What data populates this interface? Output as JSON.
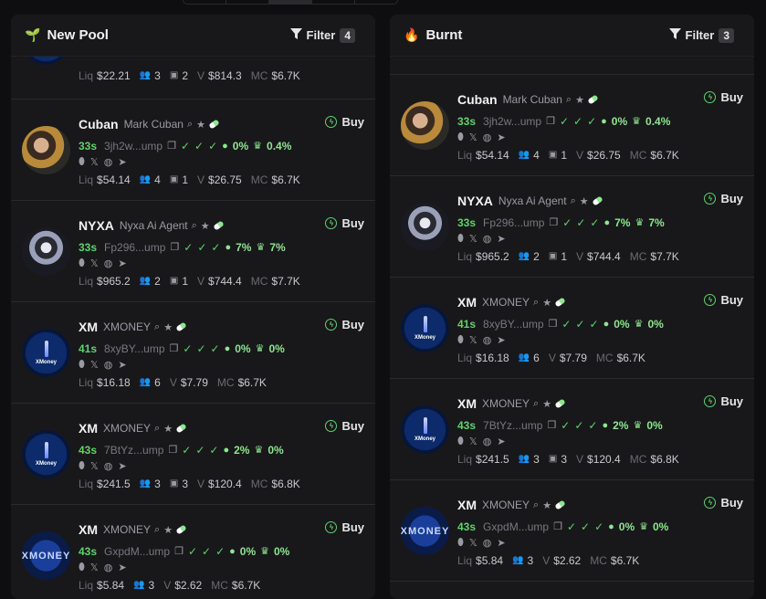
{
  "left_panel": {
    "title": "New Pool",
    "filter_label": "Filter",
    "filter_count": "4",
    "partial_top": {
      "liq": "$22.21",
      "holders": "3",
      "snipers": "2",
      "vol": "$814.3",
      "mc": "$6.7K"
    },
    "rows": [
      {
        "symbol": "Cuban",
        "name": "Mark Cuban",
        "age": "33s",
        "addr": "3jh2w...ump",
        "dev_pct": "0%",
        "top_pct": "0.4%",
        "liq": "$54.14",
        "holders": "4",
        "snipers": "1",
        "vol": "$26.75",
        "mc": "$6.7K",
        "buy": "Buy"
      },
      {
        "symbol": "NYXA",
        "name": "Nyxa Ai Agent",
        "age": "33s",
        "addr": "Fp296...ump",
        "dev_pct": "7%",
        "top_pct": "7%",
        "liq": "$965.2",
        "holders": "2",
        "snipers": "1",
        "vol": "$744.4",
        "mc": "$7.7K",
        "buy": "Buy"
      },
      {
        "symbol": "XM",
        "name": "XMONEY",
        "age": "41s",
        "addr": "8xyBY...ump",
        "dev_pct": "0%",
        "top_pct": "0%",
        "liq": "$16.18",
        "holders": "6",
        "snipers": "",
        "vol": "$7.79",
        "mc": "$6.7K",
        "buy": "Buy",
        "avatar_text": "XMoney"
      },
      {
        "symbol": "XM",
        "name": "XMONEY",
        "age": "43s",
        "addr": "7BtYz...ump",
        "dev_pct": "2%",
        "top_pct": "0%",
        "liq": "$241.5",
        "holders": "3",
        "snipers": "3",
        "vol": "$120.4",
        "mc": "$6.8K",
        "buy": "Buy",
        "avatar_text": "XMoney"
      },
      {
        "symbol": "XM",
        "name": "XMONEY",
        "age": "43s",
        "addr": "GxpdM...ump",
        "dev_pct": "0%",
        "top_pct": "0%",
        "liq": "$5.84",
        "holders": "3",
        "snipers": "",
        "vol": "$2.62",
        "mc": "$6.7K",
        "buy": "Buy",
        "avatar_text": "XMONEY"
      }
    ]
  },
  "right_panel": {
    "title": "Burnt",
    "filter_label": "Filter",
    "filter_count": "3",
    "rows": [
      {
        "symbol": "Cuban",
        "name": "Mark Cuban",
        "age": "33s",
        "addr": "3jh2w...ump",
        "dev_pct": "0%",
        "top_pct": "0.4%",
        "liq": "$54.14",
        "holders": "4",
        "snipers": "1",
        "vol": "$26.75",
        "mc": "$6.7K",
        "buy": "Buy"
      },
      {
        "symbol": "NYXA",
        "name": "Nyxa Ai Agent",
        "age": "33s",
        "addr": "Fp296...ump",
        "dev_pct": "7%",
        "top_pct": "7%",
        "liq": "$965.2",
        "holders": "2",
        "snipers": "1",
        "vol": "$744.4",
        "mc": "$7.7K",
        "buy": "Buy"
      },
      {
        "symbol": "XM",
        "name": "XMONEY",
        "age": "41s",
        "addr": "8xyBY...ump",
        "dev_pct": "0%",
        "top_pct": "0%",
        "liq": "$16.18",
        "holders": "6",
        "snipers": "",
        "vol": "$7.79",
        "mc": "$6.7K",
        "buy": "Buy",
        "avatar_text": "XMoney"
      },
      {
        "symbol": "XM",
        "name": "XMONEY",
        "age": "43s",
        "addr": "7BtYz...ump",
        "dev_pct": "2%",
        "top_pct": "0%",
        "liq": "$241.5",
        "holders": "3",
        "snipers": "3",
        "vol": "$120.4",
        "mc": "$6.8K",
        "buy": "Buy",
        "avatar_text": "XMoney"
      },
      {
        "symbol": "XM",
        "name": "XMONEY",
        "age": "43s",
        "addr": "GxpdM...ump",
        "dev_pct": "0%",
        "top_pct": "0%",
        "liq": "$5.84",
        "holders": "3",
        "snipers": "",
        "vol": "$2.62",
        "mc": "$6.7K",
        "buy": "Buy",
        "avatar_text": "XMONEY"
      }
    ]
  },
  "labels": {
    "liq": "Liq",
    "vol": "V",
    "mc": "MC"
  },
  "colors": {
    "accent_green": "#5fd36a",
    "background": "#0e0e10",
    "panel": "#18181b"
  }
}
